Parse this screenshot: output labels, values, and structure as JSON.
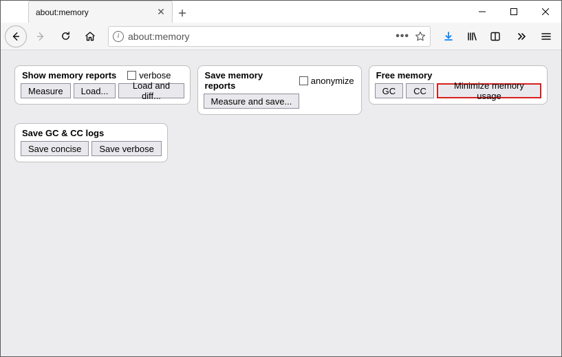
{
  "tab": {
    "title": "about:memory"
  },
  "url": {
    "value": "about:memory"
  },
  "panels": {
    "show": {
      "title": "Show memory reports",
      "verbose_label": "verbose",
      "measure": "Measure",
      "load": "Load...",
      "load_diff": "Load and diff..."
    },
    "save": {
      "title": "Save memory reports",
      "anonymize_label": "anonymize",
      "measure_save": "Measure and save..."
    },
    "free": {
      "title": "Free memory",
      "gc": "GC",
      "cc": "CC",
      "minimize": "Minimize memory usage"
    },
    "logs": {
      "title": "Save GC & CC logs",
      "save_concise": "Save concise",
      "save_verbose": "Save verbose"
    }
  }
}
